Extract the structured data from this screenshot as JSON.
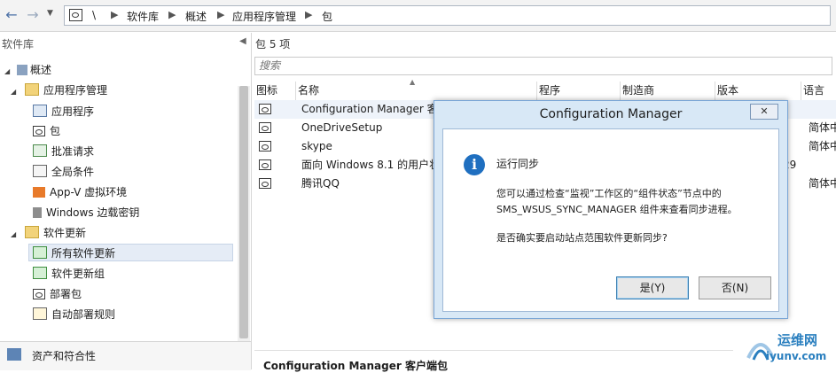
{
  "breadcrumb": {
    "root": "\\",
    "items": [
      "软件库",
      "概述",
      "应用程序管理",
      "包"
    ]
  },
  "sidebar": {
    "title": "软件库",
    "tree": [
      {
        "label": "概述",
        "level": 0
      },
      {
        "label": "应用程序管理",
        "level": 1
      },
      {
        "label": "应用程序",
        "level": 2
      },
      {
        "label": "包",
        "level": 2
      },
      {
        "label": "批准请求",
        "level": 2
      },
      {
        "label": "全局条件",
        "level": 2
      },
      {
        "label": "App-V 虚拟环境",
        "level": 2
      },
      {
        "label": "Windows 边载密钥",
        "level": 2
      },
      {
        "label": "软件更新",
        "level": 1
      },
      {
        "label": "所有软件更新",
        "level": 2,
        "selected": true
      },
      {
        "label": "软件更新组",
        "level": 2
      },
      {
        "label": "部署包",
        "level": 2
      },
      {
        "label": "自动部署规则",
        "level": 2
      }
    ],
    "bottom_nav": "资产和符合性"
  },
  "main": {
    "title": "包 5 项",
    "search_placeholder": "搜索",
    "columns": [
      "图标",
      "名称",
      "程序",
      "制造商",
      "版本",
      "语言"
    ],
    "rows": [
      {
        "name": "Configuration Manager 客户",
        "lang": ""
      },
      {
        "name": "OneDriveSetup",
        "lang": "简体中"
      },
      {
        "name": "skype",
        "lang": "简体中"
      },
      {
        "name": "面向 Windows 8.1 的用户状",
        "lang": "29"
      },
      {
        "name": "腾讯QQ",
        "lang": "简体中"
      }
    ],
    "details_title": "Configuration Manager 客户端包"
  },
  "dialog": {
    "title": "Configuration Manager",
    "close": "✕",
    "heading": "运行同步",
    "line1": "您可以通过检查“监视”工作区的“组件状态”节点中的",
    "line2": "SMS_WSUS_SYNC_MANAGER 组件来查看同步进程。",
    "question": "是否确实要启动站点范围软件更新同步?",
    "yes": "是(Y)",
    "no": "否(N)"
  },
  "watermark": {
    "name": "运维网",
    "url": "iyunv.com"
  }
}
